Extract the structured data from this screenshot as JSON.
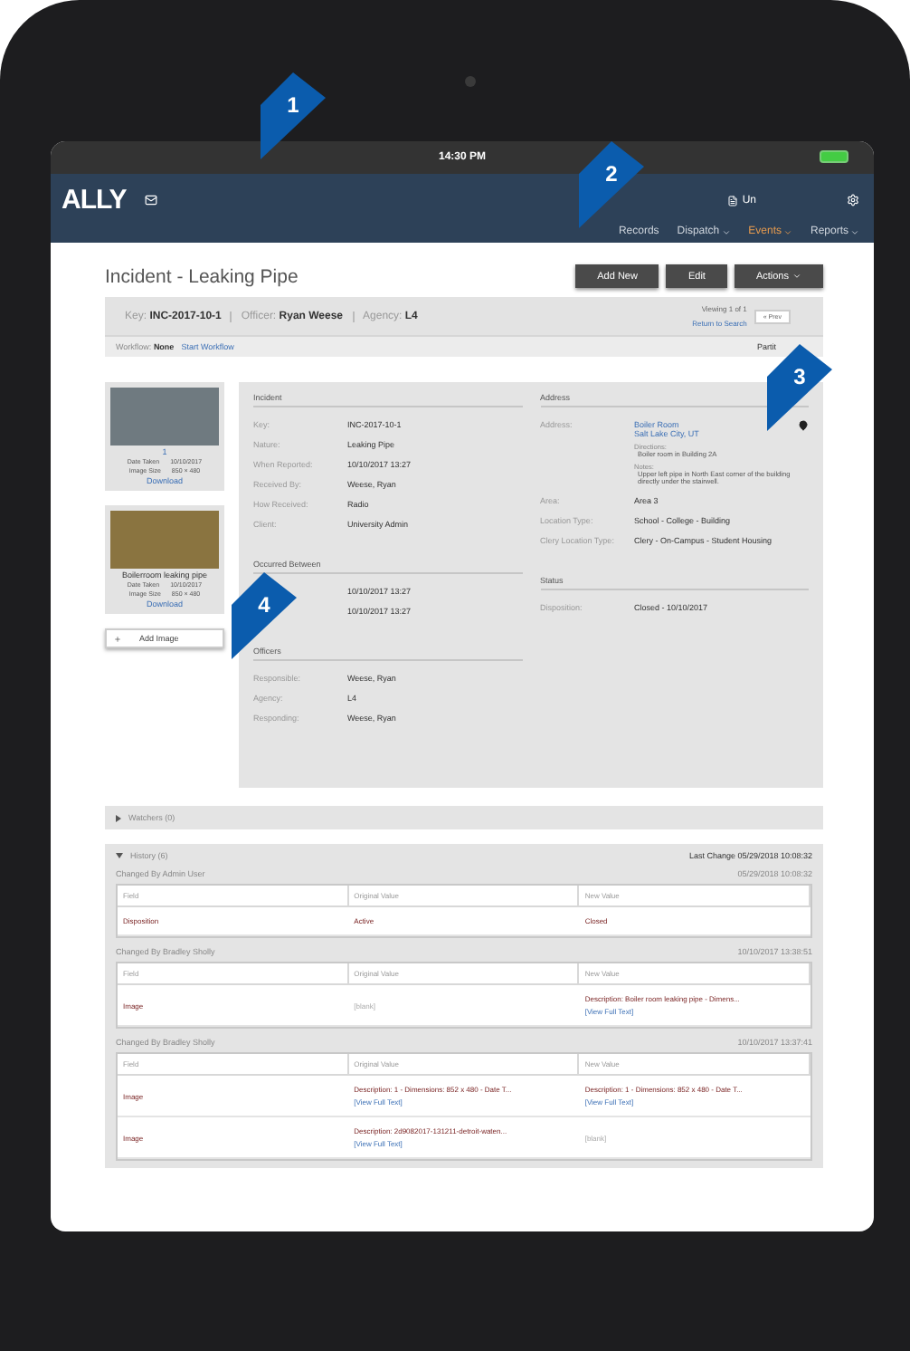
{
  "status_bar": {
    "time": "14:30 PM"
  },
  "header": {
    "logo": "ALLY",
    "doc_link": "Un",
    "nav": [
      {
        "label": "Records",
        "selected": false,
        "dropdown": false
      },
      {
        "label": "Dispatch",
        "selected": false,
        "dropdown": true
      },
      {
        "label": "Events",
        "selected": true,
        "dropdown": true
      },
      {
        "label": "Reports",
        "selected": false,
        "dropdown": true
      }
    ]
  },
  "page": {
    "title": "Incident - Leaking Pipe",
    "buttons": [
      {
        "label": "Add New",
        "dropdown": false
      },
      {
        "label": "Edit",
        "dropdown": false
      },
      {
        "label": "Actions",
        "dropdown": true
      }
    ]
  },
  "summary": {
    "fields": [
      {
        "label": "Key:",
        "value": "INC-2017-10-1"
      },
      {
        "label": "Officer:",
        "value": "Ryan Weese"
      },
      {
        "label": "Agency:",
        "value": "L4"
      }
    ],
    "viewing": "Viewing 1 of 1",
    "return_link": "Return to Search",
    "prev_button": "« Prev"
  },
  "workflow": {
    "label": "Workflow:",
    "value": "None",
    "link": "Start Workflow",
    "partition": "Partit"
  },
  "images": [
    {
      "caption": "1",
      "date_label": "Date Taken",
      "date": "10/10/2017",
      "size_label": "Image Size",
      "size": "850 × 480",
      "download": "Download"
    },
    {
      "caption": "Boilerroom leaking pipe",
      "date_label": "Date Taken",
      "date": "10/10/2017",
      "size_label": "Image Size",
      "size": "850 × 480",
      "download": "Download"
    }
  ],
  "add_image": "Add Image",
  "left_sections": [
    {
      "title": "Incident",
      "fields": [
        {
          "label": "Key:",
          "value": "INC-2017-10-1"
        },
        {
          "label": "Nature:",
          "value": "Leaking Pipe"
        },
        {
          "label": "When Reported:",
          "value": "10/10/2017 13:27"
        },
        {
          "label": "Received By:",
          "value": "Weese, Ryan"
        },
        {
          "label": "How Received:",
          "value": "Radio"
        },
        {
          "label": "Client:",
          "value": "University Admin"
        }
      ]
    },
    {
      "title": "Occurred Between",
      "fields": [
        {
          "value": "10/10/2017 13:27"
        },
        {
          "value": "10/10/2017 13:27"
        }
      ]
    },
    {
      "title": "Officers",
      "fields": [
        {
          "label": "Responsible:",
          "value": "Weese, Ryan"
        },
        {
          "label": "Agency:",
          "value": "L4"
        },
        {
          "label": "Responding:",
          "value": "Weese, Ryan"
        }
      ]
    }
  ],
  "address": {
    "title": "Address",
    "label": "Address:",
    "lines": [
      "Boiler Room",
      "Salt Lake City, UT"
    ],
    "directions_label": "Directions:",
    "directions": "Boiler room in Building 2A",
    "notes_label": "Notes:",
    "notes": "Upper left pipe in North East corner of the building directly under the stairwell.",
    "fields": [
      {
        "label": "Area:",
        "value": "Area 3"
      },
      {
        "label": "Location Type:",
        "value": "School - College - Building"
      },
      {
        "label": "Clery Location Type:",
        "value": "Clery - On-Campus - Student Housing"
      }
    ]
  },
  "status": {
    "title": "Status",
    "fields": [
      {
        "label": "Disposition:",
        "value": "Closed - 10/10/2017"
      }
    ]
  },
  "watchers": {
    "label": "Watchers (0)",
    "expanded": false
  },
  "history": {
    "label": "History (6)",
    "expanded": true,
    "last_change": "Last Change 05/29/2018 10:08:32",
    "groups": [
      {
        "by": "Changed By Admin User",
        "time": "05/29/2018 10:08:32",
        "columns": [
          "Field",
          "Original Value",
          "New Value"
        ],
        "rows": [
          {
            "field": "Disposition",
            "original": {
              "text": "Active",
              "blank": false
            },
            "new": {
              "text": "Closed",
              "blank": false
            }
          }
        ]
      },
      {
        "by": "Changed By Bradley Sholly",
        "time": "10/10/2017 13:38:51",
        "columns": [
          "Field",
          "Original Value",
          "New Value"
        ],
        "rows": [
          {
            "field": "Image",
            "original": {
              "text": "[blank]",
              "blank": true
            },
            "new": {
              "text": "Description: Boiler room leaking pipe - Dimens...",
              "link": "[View Full Text]",
              "blank": false
            }
          }
        ]
      },
      {
        "by": "Changed By Bradley Sholly",
        "time": "10/10/2017 13:37:41",
        "columns": [
          "Field",
          "Original Value",
          "New Value"
        ],
        "rows": [
          {
            "field": "Image",
            "original": {
              "text": "Description: 1 - Dimensions: 852 x 480 - Date T...",
              "link": "[View Full Text]",
              "blank": false
            },
            "new": {
              "text": "Description: 1 - Dimensions: 852 x 480 - Date T...",
              "link": "[View Full Text]",
              "blank": false
            }
          },
          {
            "field": "Image",
            "original": {
              "text": "Description: 2d9082017-131211-detroit-waten...",
              "link": "[View Full Text]",
              "blank": false
            },
            "new": {
              "text": "[blank]",
              "blank": true
            }
          }
        ]
      }
    ]
  },
  "callouts": [
    "1",
    "2",
    "3",
    "4"
  ]
}
